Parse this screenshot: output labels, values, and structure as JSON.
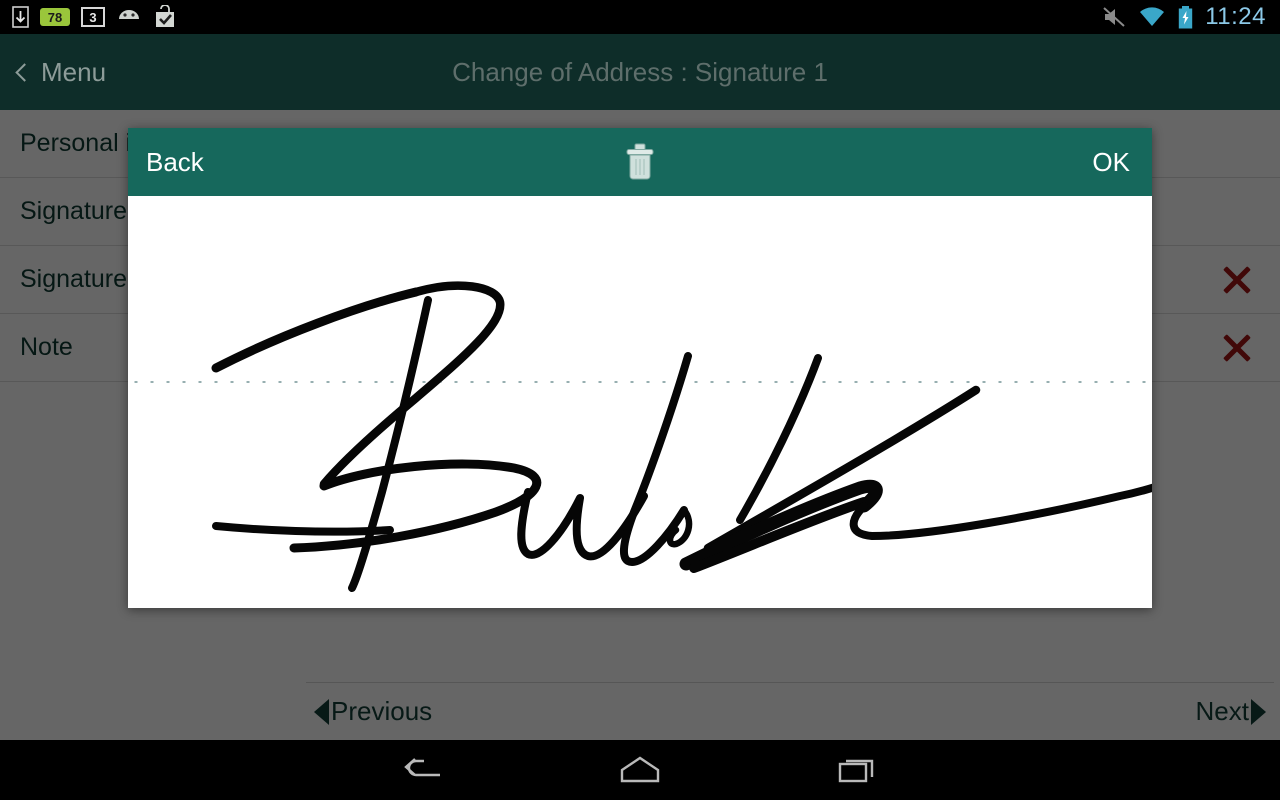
{
  "statusbar": {
    "icons_left": [
      "download-icon",
      "battery-level-icon",
      "sd-card-icon",
      "android-robot-icon",
      "app-check-icon"
    ],
    "battery_level_label": "78",
    "sd_label": "3",
    "icons_right": [
      "mute-icon",
      "wifi-icon",
      "battery-charging-icon"
    ],
    "clock": "11:24"
  },
  "titlebar": {
    "back_label": "Menu",
    "back_icon": "chevron-left-icon",
    "title": "Change of Address : Signature 1"
  },
  "form": {
    "rows": [
      {
        "label": "Personal i",
        "has_delete": false,
        "delete_icon": ""
      },
      {
        "label": "Signature",
        "has_delete": false,
        "delete_icon": ""
      },
      {
        "label": "Signature",
        "has_delete": true,
        "delete_icon": "close-x-icon"
      },
      {
        "label": "Note",
        "has_delete": true,
        "delete_icon": "close-x-icon"
      }
    ]
  },
  "footer": {
    "previous_label": "Previous",
    "previous_icon": "chevron-left-icon",
    "next_label": "Next",
    "next_icon": "chevron-right-icon"
  },
  "dialog": {
    "back_label": "Back",
    "ok_label": "OK",
    "clear_icon": "trash-icon",
    "signature_present": true,
    "baseline_style": "dotted"
  },
  "navbar": {
    "back_icon": "nav-back-icon",
    "home_icon": "nav-home-icon",
    "recents_icon": "nav-recents-icon"
  },
  "colors": {
    "titlebar": "#0e2d29",
    "dialog_bar": "#16685c",
    "accent_text": "#123f38",
    "delete_red": "#a31515",
    "clock_blue": "#8cc9e8",
    "scrim": "rgba(0,0,0,.60)"
  }
}
